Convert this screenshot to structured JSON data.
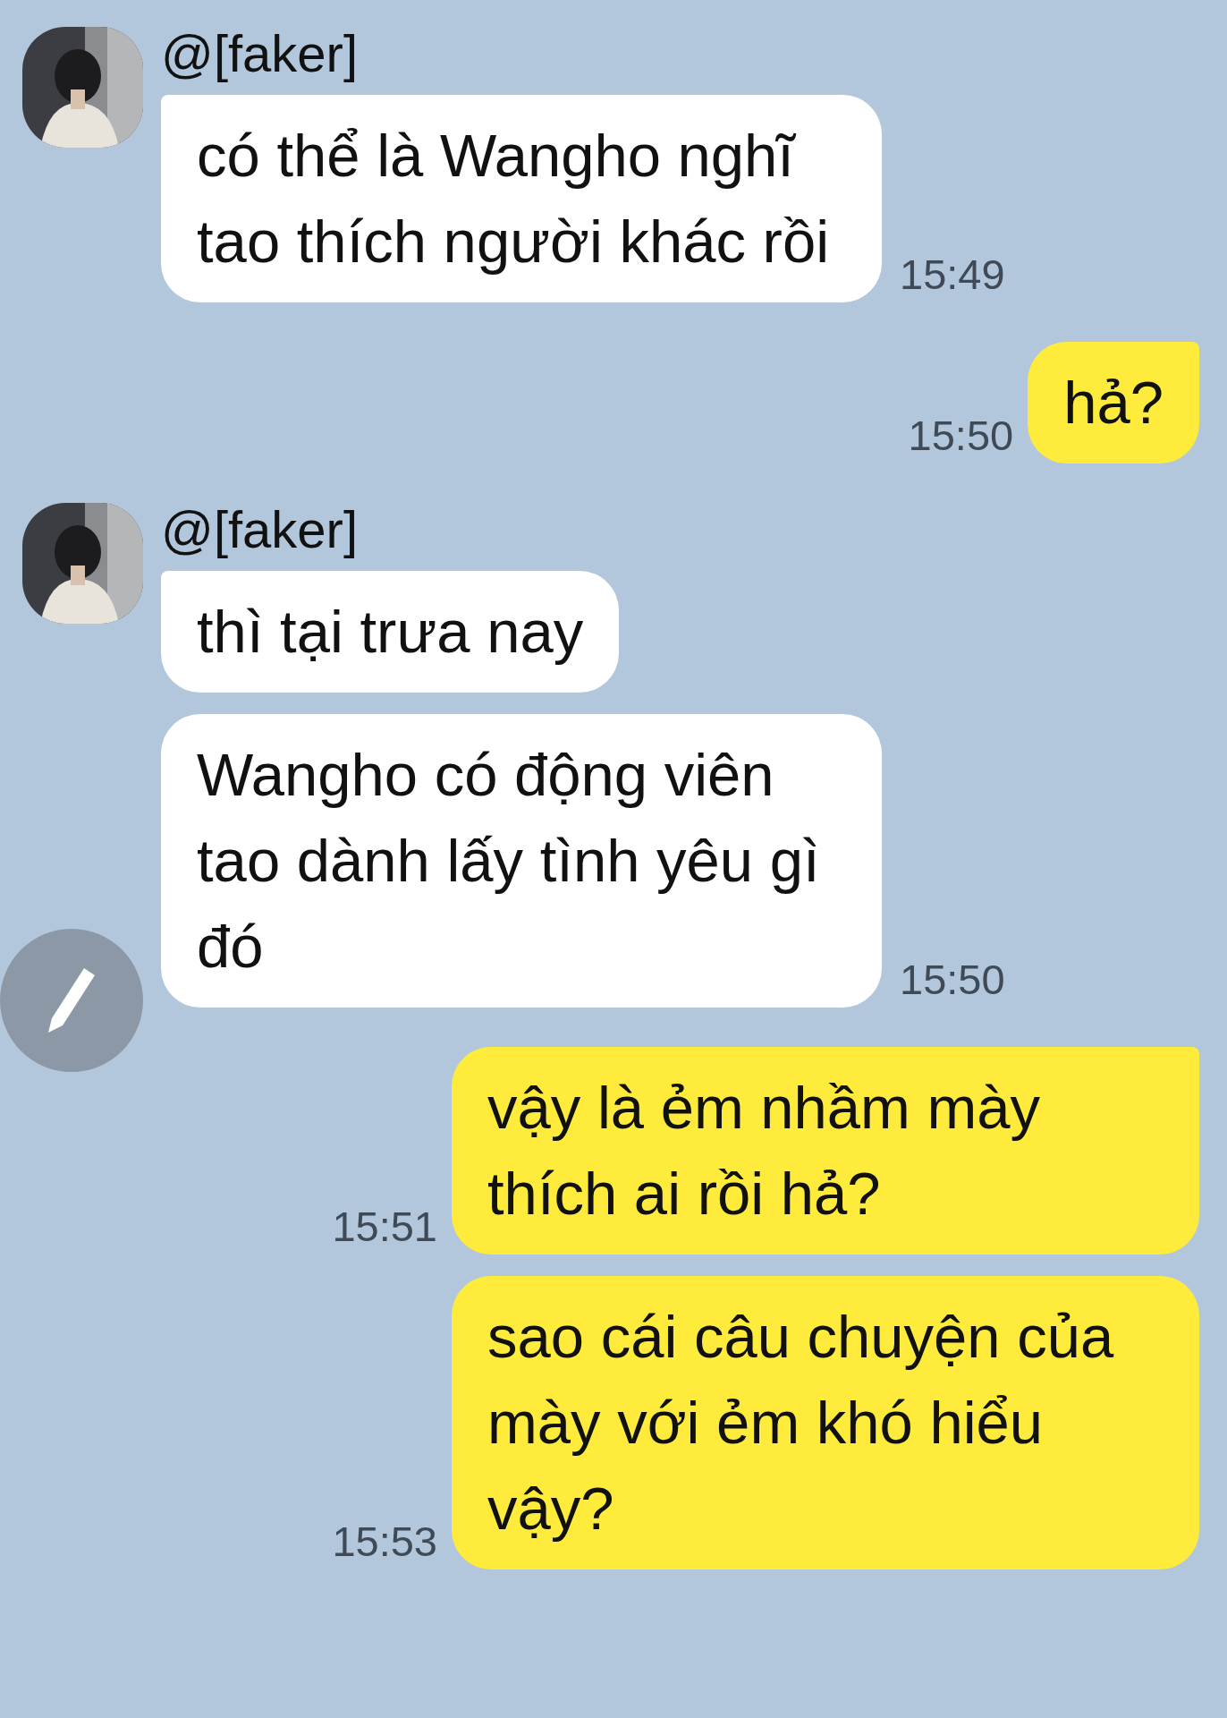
{
  "messages": [
    {
      "kind": "incoming",
      "sender": "@[faker]",
      "avatar": {
        "kind": "picture"
      },
      "bubbles": [
        {
          "text": "có thể là Wangho nghĩ tao thích người khác rồi",
          "time": "15:49"
        }
      ]
    },
    {
      "kind": "outgoing",
      "bubbles": [
        {
          "text": "hả?",
          "time": "15:50"
        }
      ]
    },
    {
      "kind": "incoming",
      "sender": "@[faker]",
      "avatar": {
        "kind": "picture"
      },
      "bubbles": [
        {
          "text": "thì tại trưa nay"
        },
        {
          "text": "Wangho có động viên tao dành lấy tình yêu gì đó",
          "time": "15:50"
        }
      ]
    },
    {
      "kind": "outgoing",
      "bubbles": [
        {
          "text": "vậy là ẻm nhầm mày thích ai rồi hả?",
          "time": "15:51"
        },
        {
          "text": "sao cái câu chuyện của mày với ẻm khó hiểu vậy?",
          "time": "15:53"
        }
      ]
    }
  ]
}
